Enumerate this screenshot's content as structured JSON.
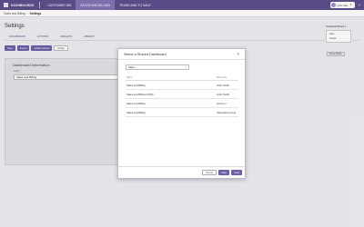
{
  "topbar": {
    "brand": "DASHBOARDS",
    "tabs": [
      {
        "label": "CUSTOMER 360",
        "active": false
      },
      {
        "label": "SALES AND BILLING",
        "active": true
      },
      {
        "label": "TRADE AND TO SALE",
        "active": false
      }
    ],
    "user_name": "john doe"
  },
  "breadcrumb": {
    "parent": "Sales and Billing",
    "current": "Settings"
  },
  "settings": {
    "title": "Settings",
    "tabs": [
      "DASHBOARD",
      "ACTIONS",
      "WIDGETS",
      "LIBRARY"
    ],
    "buttons": [
      "Save",
      "Export",
      "Update shared",
      "Delete"
    ],
    "panel_title": "Dashboard Information",
    "name_label": "Label *",
    "name_value": "Sales and Billing"
  },
  "side_panel": {
    "header": "Individual Board",
    "menu": [
      "New",
      "Import"
    ],
    "button": "From library"
  },
  "modal": {
    "title": "Select a Shared Dashboard",
    "search_value": "Sales",
    "columns": [
      "Name",
      "Shared By"
    ],
    "rows": [
      {
        "name": "Sales and Billing",
        "shared_by": "John Smith"
      },
      {
        "name": "Sales and Billing (2019)",
        "shared_by": "John Smith"
      },
      {
        "name": "Sales and Billing",
        "shared_by": "Anna Lu"
      },
      {
        "name": "Sales and Billing",
        "shared_by": "Alexandra Lerner"
      }
    ],
    "buttons": {
      "cancel": "Cancel",
      "clear": "Clear",
      "load": "Load"
    }
  },
  "colors": {
    "brand": "#5c4f8c",
    "accent": "#6d5ea6",
    "active_tab": "#8374b6"
  }
}
